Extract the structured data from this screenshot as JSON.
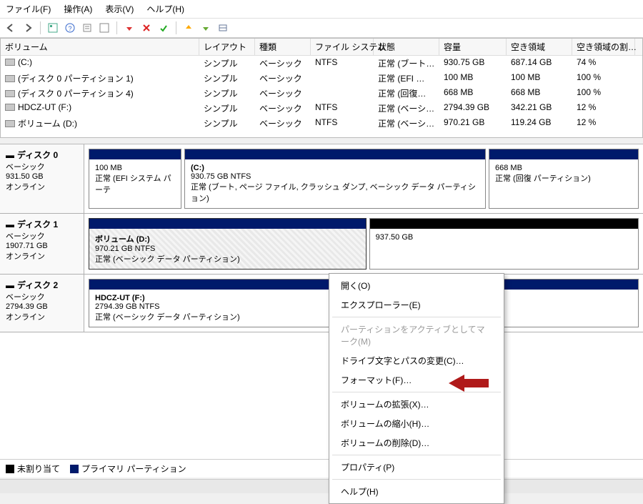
{
  "menu": {
    "file": "ファイル(F)",
    "action": "操作(A)",
    "view": "表示(V)",
    "help": "ヘルプ(H)"
  },
  "list": {
    "headers": {
      "volume": "ボリューム",
      "layout": "レイアウト",
      "type": "種類",
      "fs": "ファイル システム",
      "status": "状態",
      "capacity": "容量",
      "free": "空き領域",
      "pct": "空き領域の割…"
    },
    "rows": [
      {
        "vol": "(C:)",
        "layout": "シンプル",
        "type": "ベーシック",
        "fs": "NTFS",
        "status": "正常 (ブート…",
        "cap": "930.75 GB",
        "free": "687.14 GB",
        "pct": "74 %"
      },
      {
        "vol": "(ディスク 0 パーティション 1)",
        "layout": "シンプル",
        "type": "ベーシック",
        "fs": "",
        "status": "正常 (EFI …",
        "cap": "100 MB",
        "free": "100 MB",
        "pct": "100 %"
      },
      {
        "vol": "(ディスク 0 パーティション 4)",
        "layout": "シンプル",
        "type": "ベーシック",
        "fs": "",
        "status": "正常 (回復…",
        "cap": "668 MB",
        "free": "668 MB",
        "pct": "100 %"
      },
      {
        "vol": "HDCZ-UT (F:)",
        "layout": "シンプル",
        "type": "ベーシック",
        "fs": "NTFS",
        "status": "正常 (ベーシ…",
        "cap": "2794.39 GB",
        "free": "342.21 GB",
        "pct": "12 %"
      },
      {
        "vol": "ボリューム (D:)",
        "layout": "シンプル",
        "type": "ベーシック",
        "fs": "NTFS",
        "status": "正常 (ベーシ…",
        "cap": "970.21 GB",
        "free": "119.24 GB",
        "pct": "12 %"
      }
    ]
  },
  "disks": {
    "d0": {
      "title": "ディスク 0",
      "type": "ベーシック",
      "size": "931.50 GB",
      "state": "オンライン",
      "p0": {
        "title": "",
        "line1": "100 MB",
        "line2": "正常 (EFI システム パーテ"
      },
      "p1": {
        "title": "(C:)",
        "line1": "930.75 GB NTFS",
        "line2": "正常 (ブート, ページ ファイル, クラッシュ ダンプ, ベーシック データ パーティション)"
      },
      "p2": {
        "title": "",
        "line1": "668 MB",
        "line2": "正常 (回復 パーティション)"
      }
    },
    "d1": {
      "title": "ディスク 1",
      "type": "ベーシック",
      "size": "1907.71 GB",
      "state": "オンライン",
      "p0": {
        "title": "ボリューム  (D:)",
        "line1": "970.21 GB NTFS",
        "line2": "正常 (ベーシック データ パーティション)"
      },
      "p1": {
        "title": "",
        "line1": "937.50 GB",
        "line2": ""
      }
    },
    "d2": {
      "title": "ディスク 2",
      "type": "ベーシック",
      "size": "2794.39 GB",
      "state": "オンライン",
      "p0": {
        "title": "HDCZ-UT  (F:)",
        "line1": "2794.39 GB NTFS",
        "line2": "正常 (ベーシック データ パーティション)"
      }
    }
  },
  "legend": {
    "unalloc": "未割り当て",
    "primary": "プライマリ パーティション"
  },
  "ctxmenu": {
    "open": "開く(O)",
    "explorer": "エクスプローラー(E)",
    "active": "パーティションをアクティブとしてマーク(M)",
    "changeletter": "ドライブ文字とパスの変更(C)…",
    "format": "フォーマット(F)…",
    "extend": "ボリュームの拡張(X)…",
    "shrink": "ボリュームの縮小(H)…",
    "delete": "ボリュームの削除(D)…",
    "prop": "プロパティ(P)",
    "help": "ヘルプ(H)"
  }
}
